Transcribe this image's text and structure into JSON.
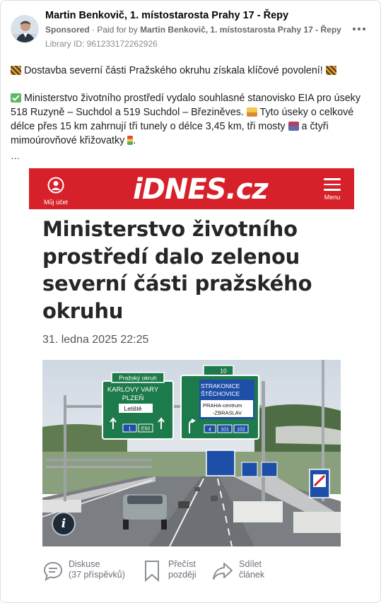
{
  "post": {
    "author": "Martin Benkovič, 1. místostarosta Prahy 17 - Řepy",
    "sponsored_label": "Sponsored",
    "paid_for_prefix": "Paid for by",
    "paid_for_name": "Martin Benkovič, 1. místostarosta Prahy 17 - Řepy",
    "library_id": "Library ID: 961233172262926",
    "more_icon": "more-horizontal-icon",
    "paragraph1": " Dostavba severní části Pražského okruhu získala klíčové povolení! ",
    "paragraph2_part1": " Ministerstvo životního prostředí vydalo souhlasné stanovisko EIA pro úseky 518 Ruzyně – Suchdol a 519 Suchdol – Březiněves. ",
    "paragraph2_part2": " Tyto úseky o celkové délce přes 15 km zahrnují tři tunely o délce 3,45 km, tři mosty ",
    "paragraph2_part3": " a čtyři mimoúrovňové křižovatky ",
    "paragraph2_end": ".",
    "see_more": "…"
  },
  "article": {
    "site_logo": "iDNES.cz",
    "account_label": "Můj účet",
    "menu_label": "Menu",
    "headline": "Ministerstvo životního prostředí dalo zelenou severní části pražského okruhu",
    "date": "31. ledna 2025  22:25",
    "photo_signs": {
      "sign1_header": "Pražský okruh",
      "sign1_line1": "KARLOVY VARY",
      "sign1_line2": "PLZEŇ",
      "sign1_line3": "Letiště",
      "sign1_route1": "1",
      "sign1_route2": "E50",
      "exit_number": "10",
      "sign2_line1": "STRAKONICE",
      "sign2_line2": "ŠTĚCHOVICE",
      "sign2_line3": "PRAHA-centrum",
      "sign2_line4": "-ZBRASLAV",
      "sign2_route1": "4",
      "sign2_route2": "101",
      "sign2_route3": "102"
    },
    "actions": {
      "discussion_label": "Diskuse",
      "discussion_count": "(37 příspěvků)",
      "read_later_1": "Přečíst",
      "read_later_2": "později",
      "share_1": "Sdílet",
      "share_2": "článek"
    }
  },
  "colors": {
    "brand_red": "#d7212a",
    "sign_green": "#1d7a4a",
    "sign_blue": "#1d4ea8",
    "meta_gray": "#65676b"
  }
}
